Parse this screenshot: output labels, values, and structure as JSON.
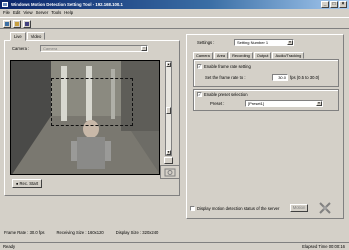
{
  "window": {
    "title": "Windows Motion Detection Setting Tool - 192.168.100.1",
    "minimize": "_",
    "maximize": "□",
    "close": "×"
  },
  "menu": [
    "File",
    "Edit",
    "View",
    "Server",
    "Tools",
    "Help"
  ],
  "toolbar": [
    "new-icon",
    "open-icon",
    "save-icon"
  ],
  "left_tabs": [
    "Live",
    "Video"
  ],
  "camera": {
    "label": "Camera :",
    "value": "Camera"
  },
  "rec_button": "● Rec. Start",
  "settings": {
    "label": "Settings :",
    "value": "Setting Number 1"
  },
  "inner_tabs": [
    "Camera",
    "Area",
    "Recording",
    "Output",
    "Audio/Tracking"
  ],
  "frame_rate": {
    "checkbox_label": "Enable frame rate setting",
    "set_label": "Set the frame rate to :",
    "value": "30.0",
    "unit": "fps (0.5 to 30.0)"
  },
  "preset": {
    "checkbox_label": "Enable preset selection",
    "label": "Preset :",
    "value": "[Preset1]"
  },
  "display_status": {
    "label": "Display motion detection status of the server",
    "button": "Motion"
  },
  "status_info": {
    "frame_rate": "Frame Rate : 30.0 fps",
    "receiving": "Receiving Size : 160x120",
    "display": "Display Size : 320x240"
  },
  "statusbar": {
    "left": "Ready",
    "right": "Elapsed Time 00:00:16"
  }
}
